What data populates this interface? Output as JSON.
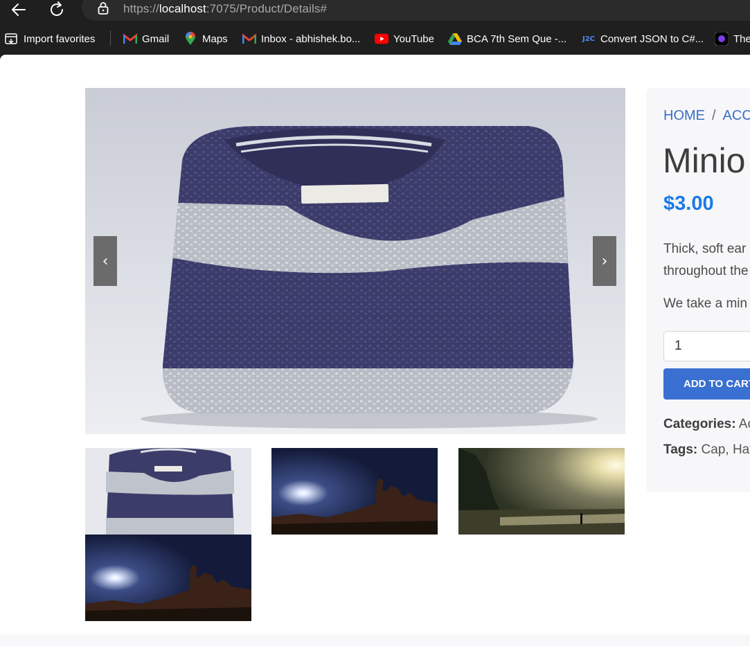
{
  "browser": {
    "url_prefix": "https://",
    "url_host": "localhost",
    "url_rest": ":7075/Product/Details#"
  },
  "favorites": [
    {
      "label": "Import favorites",
      "icon": "import-icon"
    },
    {
      "label": "Gmail",
      "icon": "gmail-icon"
    },
    {
      "label": "Maps",
      "icon": "maps-icon"
    },
    {
      "label": "Inbox - abhishek.bo...",
      "icon": "gmail-icon"
    },
    {
      "label": "YouTube",
      "icon": "youtube-icon"
    },
    {
      "label": "BCA 7th Sem Que -...",
      "icon": "drive-icon"
    },
    {
      "label": "Convert JSON to C#...",
      "icon": "json2csharp-icon"
    },
    {
      "label": "The",
      "icon": "site-icon"
    }
  ],
  "carousel": {
    "prev_label": "‹",
    "next_label": "›"
  },
  "product": {
    "breadcrumb_home": "HOME",
    "breadcrumb_sep": "/",
    "breadcrumb_cat": "ACC",
    "title": "Minio",
    "price": "$3.00",
    "desc_line1": "Thick, soft ear",
    "desc_line2": "throughout the",
    "desc2": "We take a min",
    "quantity": "1",
    "add_to_cart": "ADD TO CART",
    "categories_label": "Categories:",
    "categories_value": "Ac",
    "tags_label": "Tags:",
    "tags_value": "Cap, Hat"
  },
  "colors": {
    "accent": "#3a70d2",
    "price": "#1a7ae8",
    "link": "#3a6fc4"
  }
}
